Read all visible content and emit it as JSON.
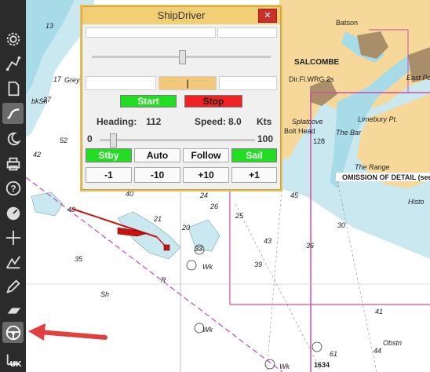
{
  "dialog": {
    "title": "ShipDriver",
    "close_label": "✕",
    "rudder_value": "|",
    "start_label": "Start",
    "stop_label": "Stop",
    "heading_label": "Heading:",
    "heading_value": "112",
    "speed_label": "Speed:",
    "speed_value": "8.0",
    "speed_unit": "Kts",
    "slider_min": "0",
    "slider_max": "100",
    "speed_slider_fraction": 0.08,
    "rudder_slider_fraction": 0.5,
    "buttons_row1": [
      "Stby",
      "Auto",
      "Follow",
      "Sail"
    ],
    "buttons_row2": [
      "-1",
      "-10",
      "+10",
      "+1"
    ]
  },
  "toolbar": {
    "uk_label": "UK",
    "icons": [
      "gear-icon",
      "route-icon",
      "document-icon",
      "tracks-icon",
      "moon-icon",
      "print-icon",
      "help-icon",
      "dashboard-icon",
      "crosshair-icon",
      "chart-tools-icon",
      "pencil-icon",
      "layers-icon",
      "steering-wheel-icon",
      "ruler-icon"
    ]
  },
  "chart": {
    "places": {
      "salcombe": "SALCOMBE",
      "batson": "Batson",
      "limebury": "Limebury Pt.",
      "bolt_head": "Bolt Head",
      "the_bar": "The Bar",
      "the_range": "The Range",
      "splatcove": "Splatcove",
      "east_portlemouth": "East Portlem",
      "omission": "OMISSION OF DETAIL (see",
      "light": "Dir.Fl.WRG 2s"
    },
    "soundings": [
      "13",
      "17",
      "27",
      "42",
      "52",
      "33",
      "39",
      "35",
      "40",
      "26",
      "25",
      "24",
      "20",
      "21",
      "40",
      "45",
      "43",
      "36",
      "30",
      "41",
      "44",
      "128",
      "1634",
      "61"
    ],
    "labels": {
      "greys": "Greys",
      "bk_sh": "bkSh",
      "wk": "Wk",
      "sh": "Sh",
      "r": "R",
      "obstn": "Obstn",
      "histo": "Histo"
    }
  }
}
